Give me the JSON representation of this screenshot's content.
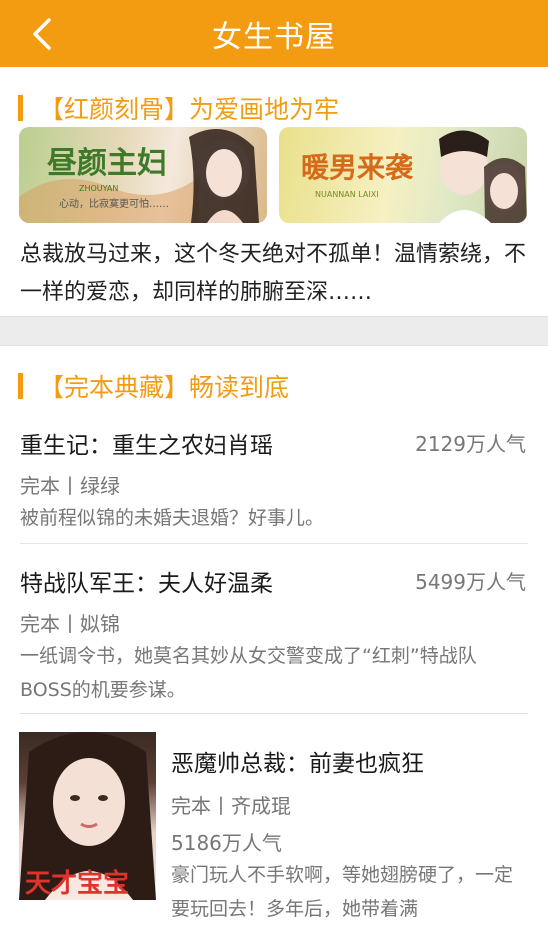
{
  "header": {
    "title": "女生书屋"
  },
  "section1": {
    "title": "【红颜刻骨】为爱画地为牢",
    "banners": [
      {
        "name": "昼颜主妇",
        "caption": "心动，比寂寞更可怕……",
        "pinyin": "ZHOUYAN"
      },
      {
        "name": "暖男来袭",
        "pinyin": "NUANNAN LAIXI"
      }
    ],
    "intro": "总裁放马过来，这个冬天绝对不孤单！温情萦绕，不一样的爱恋，却同样的肺腑至深……"
  },
  "section2": {
    "title": "【完本典藏】畅读到底",
    "books": [
      {
        "title": "重生记：重生之农妇肖瑶",
        "popularity": "2129万人气",
        "meta": "完本丨绿绿",
        "desc": "被前程似锦的未婚夫退婚？好事儿。"
      },
      {
        "title": "特战队军王：夫人好温柔",
        "popularity": "5499万人气",
        "meta": "完本丨姒锦",
        "desc": "一纸调令书，她莫名其妙从女交警变成了“红刺”特战队BOSS的机要参谋。"
      },
      {
        "title": "恶魔帅总裁：前妻也疯狂",
        "popularity": "5186万人气",
        "meta": "完本丨齐成琨",
        "desc": "豪门玩人不手软啊，等她翅膀硬了，一定要玩回去！多年后，她带着满",
        "cover_text": "天才宝宝"
      }
    ]
  },
  "colors": {
    "accent": "#f39c12",
    "text_gray": "#777777"
  }
}
